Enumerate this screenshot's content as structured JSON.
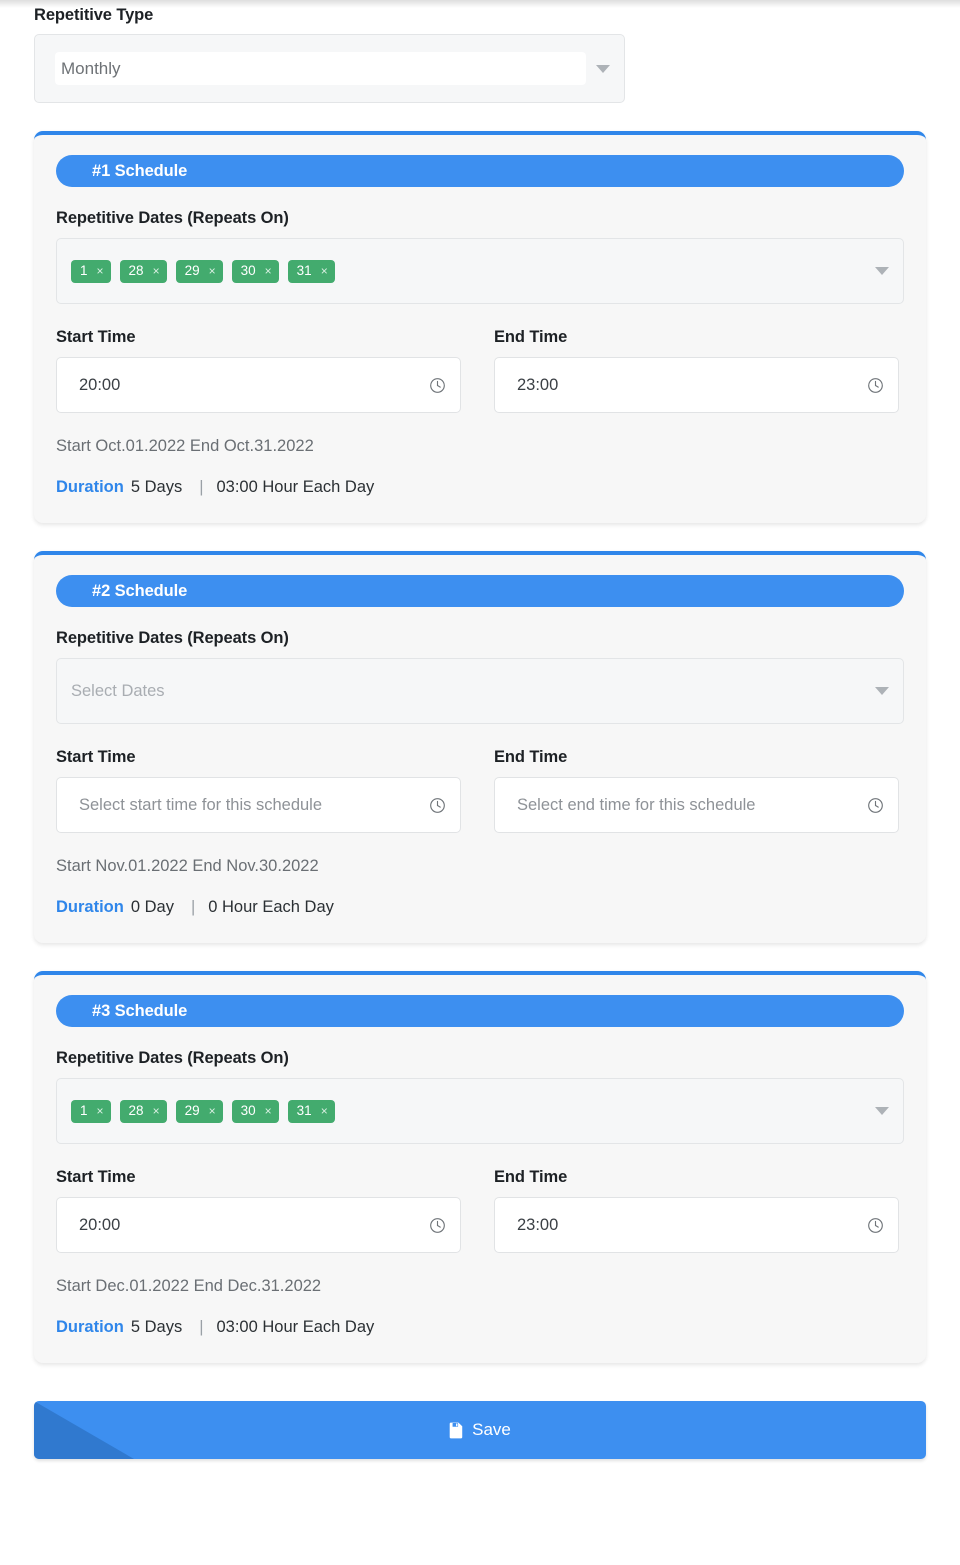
{
  "repetitive_type": {
    "label": "Repetitive Type",
    "value": "Monthly",
    "caret_icon": "chevron-down-icon"
  },
  "labels": {
    "repetitive_dates": "Repetitive Dates (Repeats On)",
    "start_time": "Start Time",
    "end_time": "End Time",
    "duration_key": "Duration",
    "separator": "|"
  },
  "placeholders": {
    "dates": "Select Dates",
    "start_time": "Select start time for this schedule",
    "end_time": "Select end time for this schedule"
  },
  "schedules": [
    {
      "title": "#1 Schedule",
      "dates": [
        "1",
        "28",
        "29",
        "30",
        "31"
      ],
      "start_time": "20:00",
      "end_time": "23:00",
      "range": "Start Oct.01.2022 End Oct.31.2022",
      "duration_days": "5 Days",
      "duration_hours": "03:00 Hour Each Day"
    },
    {
      "title": "#2 Schedule",
      "dates": [],
      "start_time": "",
      "end_time": "",
      "range": "Start Nov.01.2022 End Nov.30.2022",
      "duration_days": "0 Day",
      "duration_hours": "0 Hour Each Day"
    },
    {
      "title": "#3 Schedule",
      "dates": [
        "1",
        "28",
        "29",
        "30",
        "31"
      ],
      "start_time": "20:00",
      "end_time": "23:00",
      "range": "Start Dec.01.2022 End Dec.31.2022",
      "duration_days": "5 Days",
      "duration_hours": "03:00 Hour Each Day"
    }
  ],
  "save": {
    "label": "Save",
    "icon": "save-floppy-icon"
  },
  "colors": {
    "accent_blue": "#3d8ff0",
    "tag_green": "#43ab6e",
    "card_bg": "#f7f7f7",
    "field_bg": "#f6f7f8"
  },
  "tag_remove_glyph": "×"
}
